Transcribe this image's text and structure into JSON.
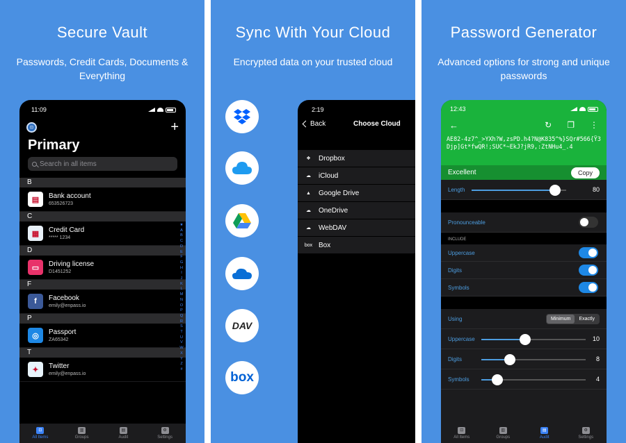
{
  "panels": {
    "vault": {
      "title": "Secure Vault",
      "subtitle": "Passwords, Credit Cards, Documents & Everything"
    },
    "sync": {
      "title": "Sync With Your Cloud",
      "subtitle": "Encrypted data on your trusted cloud"
    },
    "generator": {
      "title": "Password Generator",
      "subtitle": "Advanced options for strong and unique passwords"
    }
  },
  "vault_phone": {
    "time": "11:09",
    "vault_title": "Primary",
    "search_placeholder": "Search in all items",
    "sections": [
      {
        "letter": "B",
        "items": [
          {
            "title": "Bank account",
            "sub": "653526723",
            "color": "#ffffff"
          }
        ]
      },
      {
        "letter": "C",
        "items": [
          {
            "title": "Credit Card",
            "sub": "***** 1234",
            "color": "#e8f0f8"
          }
        ]
      },
      {
        "letter": "D",
        "items": [
          {
            "title": "Driving license",
            "sub": "D1451252",
            "color": "#e8326a"
          }
        ]
      },
      {
        "letter": "F",
        "items": [
          {
            "title": "Facebook",
            "sub": "emily@enpass.io",
            "color": "#3b5998"
          }
        ]
      },
      {
        "letter": "P",
        "items": [
          {
            "title": "Passport",
            "sub": "ZA65342",
            "color": "#1e88e5"
          }
        ]
      },
      {
        "letter": "T",
        "items": [
          {
            "title": "Twitter",
            "sub": "emily@enpass.io",
            "color": "#e8f4fb"
          }
        ]
      }
    ],
    "alphabet": [
      "★",
      "A",
      "B",
      "C",
      "D",
      "E",
      "F",
      "G",
      "H",
      "I",
      "J",
      "K",
      "L",
      "M",
      "N",
      "O",
      "P",
      "Q",
      "R",
      "S",
      "T",
      "U",
      "V",
      "W",
      "X",
      "Y",
      "Z",
      "#"
    ],
    "tabs": [
      "All Items",
      "Groups",
      "Audit",
      "Settings"
    ]
  },
  "sync_phone": {
    "time": "2:19",
    "back": "Back",
    "title": "Choose Cloud",
    "clouds": [
      "Dropbox",
      "iCloud",
      "Google Drive",
      "OneDrive",
      "WebDAV",
      "Box"
    ],
    "cloud_icons": [
      "dropbox-icon",
      "icloud-icon",
      "google-drive-icon",
      "onedrive-icon",
      "webdav-icon",
      "box-icon"
    ]
  },
  "gen_phone": {
    "time": "12:43",
    "password": "AE82-4z7^_>YXh?W,zsPD.h4?N@K835^%}SQr#566{Ÿ3Djp]Gt*fwQR!;SUC*~EkJ?jR9,:ZtNHu4_.4",
    "strength": "Excellent",
    "copy": "Copy",
    "length_label": "Length",
    "length_value": "80",
    "length_level": 0.88,
    "pronounceable": "Pronounceable",
    "include_header": "INCLUDE",
    "include": [
      "Uppercase",
      "Digits",
      "Symbols"
    ],
    "using": "Using",
    "seg": [
      "Minimum",
      "Exactly"
    ],
    "min_rows": [
      {
        "label": "Uppercase",
        "value": "10",
        "level": 0.42
      },
      {
        "label": "Digits",
        "value": "8",
        "level": 0.27
      },
      {
        "label": "Symbols",
        "value": "4",
        "level": 0.15
      }
    ],
    "tabs": [
      "All Items",
      "Groups",
      "Audit",
      "Settings"
    ]
  }
}
